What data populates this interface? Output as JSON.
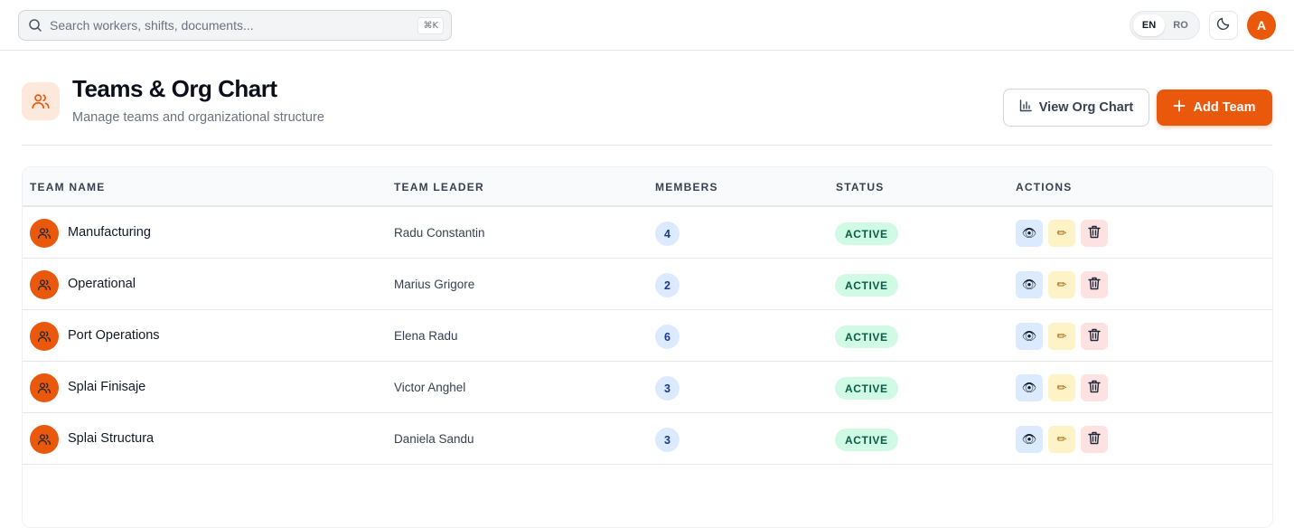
{
  "search": {
    "placeholder": "Search workers, shifts, documents...",
    "shortcut": "⌘K"
  },
  "language": {
    "options": [
      "EN",
      "RO"
    ],
    "selected": "EN"
  },
  "user": {
    "initial": "A"
  },
  "header": {
    "title": "Teams & Org Chart",
    "subtitle": "Manage teams and organizational structure",
    "view_org_chart_label": "View Org Chart",
    "add_team_label": "Add Team"
  },
  "table": {
    "columns": [
      "TEAM NAME",
      "TEAM LEADER",
      "MEMBERS",
      "STATUS",
      "ACTIONS"
    ],
    "rows": [
      {
        "name": "Manufacturing",
        "leader": "Radu Constantin",
        "members": "4",
        "status": "ACTIVE"
      },
      {
        "name": "Operational",
        "leader": "Marius Grigore",
        "members": "2",
        "status": "ACTIVE"
      },
      {
        "name": "Port Operations",
        "leader": "Elena Radu",
        "members": "6",
        "status": "ACTIVE"
      },
      {
        "name": "Splai Finisaje",
        "leader": "Victor Anghel",
        "members": "3",
        "status": "ACTIVE"
      },
      {
        "name": "Splai Structura",
        "leader": "Daniela Sandu",
        "members": "3",
        "status": "ACTIVE"
      }
    ],
    "action_icons": {
      "view": "👁",
      "edit": "✏"
    }
  },
  "colors": {
    "accent": "#ea580c",
    "status_active_bg": "#d1fae5",
    "status_active_text": "#065f46"
  }
}
